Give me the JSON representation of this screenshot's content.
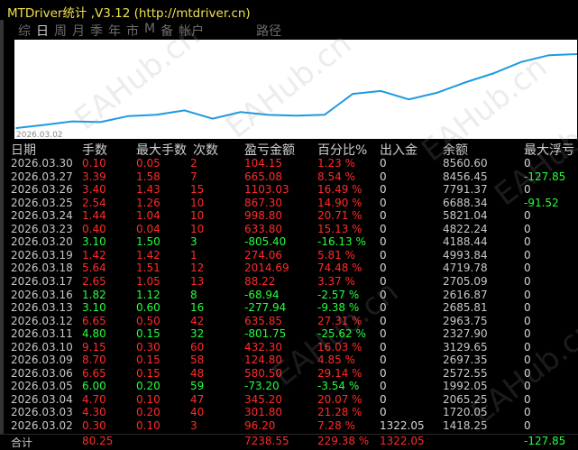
{
  "app": {
    "title": "MTDriver统计 ,V3.12 (http://mtdriver.cn)"
  },
  "tabs": [
    {
      "label": "综"
    },
    {
      "label": "日"
    },
    {
      "label": "周"
    },
    {
      "label": "月"
    },
    {
      "label": "季"
    },
    {
      "label": "年"
    },
    {
      "label": "市"
    },
    {
      "label": "M"
    },
    {
      "label": "备"
    },
    {
      "label": "帐户"
    },
    {
      "label": "路径"
    }
  ],
  "chart_data": {
    "type": "line",
    "x": [
      "2026.03.02",
      "2026.03.03",
      "2026.03.04",
      "2026.03.05",
      "2026.03.06",
      "2026.03.09",
      "2026.03.10",
      "2026.03.11",
      "2026.03.12",
      "2026.03.13",
      "2026.03.16",
      "2026.03.17",
      "2026.03.18",
      "2026.03.19",
      "2026.03.20",
      "2026.03.23",
      "2026.03.24",
      "2026.03.25",
      "2026.03.26",
      "2026.03.27",
      "2026.03.30"
    ],
    "values": [
      1418.25,
      1720.05,
      2065.25,
      1992.05,
      2572.55,
      2697.35,
      3129.65,
      2327.9,
      2963.75,
      2685.81,
      2616.87,
      2705.09,
      4719.78,
      4993.84,
      4188.44,
      4822.24,
      5821.04,
      6688.34,
      7791.37,
      8456.45,
      8560.6
    ],
    "start_label": "2026.03.02",
    "color": "#1e9ae0",
    "grid": false
  },
  "table": {
    "headers": {
      "date": "日期",
      "lots": "手数",
      "max_lots": "最大手数",
      "max_count": "次数",
      "pl": "盈亏金额",
      "pct": "百分比%",
      "io": "出入金",
      "balance": "余额",
      "float": "最大浮亏"
    },
    "rows": [
      {
        "date": "2026.03.30",
        "lots": "0.10",
        "max_lots": "0.05",
        "max_count": "2",
        "pl": "104.15",
        "pct": "1.23 %",
        "io": "0",
        "balance": "8560.60",
        "float": "0",
        "sign": "red"
      },
      {
        "date": "2026.03.27",
        "lots": "3.39",
        "max_lots": "1.58",
        "max_count": "7",
        "pl": "665.08",
        "pct": "8.54 %",
        "io": "0",
        "balance": "8456.45",
        "float": "-127.85",
        "sign": "red"
      },
      {
        "date": "2026.03.26",
        "lots": "3.40",
        "max_lots": "1.43",
        "max_count": "15",
        "pl": "1103.03",
        "pct": "16.49 %",
        "io": "0",
        "balance": "7791.37",
        "float": "0",
        "sign": "red"
      },
      {
        "date": "2026.03.25",
        "lots": "2.54",
        "max_lots": "1.26",
        "max_count": "10",
        "pl": "867.30",
        "pct": "14.90 %",
        "io": "0",
        "balance": "6688.34",
        "float": "-91.52",
        "sign": "red"
      },
      {
        "date": "2026.03.24",
        "lots": "1.44",
        "max_lots": "1.04",
        "max_count": "10",
        "pl": "998.80",
        "pct": "20.71 %",
        "io": "0",
        "balance": "5821.04",
        "float": "0",
        "sign": "red"
      },
      {
        "date": "2026.03.23",
        "lots": "0.40",
        "max_lots": "0.04",
        "max_count": "10",
        "pl": "633.80",
        "pct": "15.13 %",
        "io": "0",
        "balance": "4822.24",
        "float": "0",
        "sign": "red"
      },
      {
        "date": "2026.03.20",
        "lots": "3.10",
        "max_lots": "1.50",
        "max_count": "3",
        "pl": "-805.40",
        "pct": "-16.13 %",
        "io": "0",
        "balance": "4188.44",
        "float": "0",
        "sign": "green"
      },
      {
        "date": "2026.03.19",
        "lots": "1.42",
        "max_lots": "1.42",
        "max_count": "1",
        "pl": "274.06",
        "pct": "5.81 %",
        "io": "0",
        "balance": "4993.84",
        "float": "0",
        "sign": "red"
      },
      {
        "date": "2026.03.18",
        "lots": "5.64",
        "max_lots": "1.51",
        "max_count": "12",
        "pl": "2014.69",
        "pct": "74.48 %",
        "io": "0",
        "balance": "4719.78",
        "float": "0",
        "sign": "red"
      },
      {
        "date": "2026.03.17",
        "lots": "2.65",
        "max_lots": "1.05",
        "max_count": "13",
        "pl": "88.22",
        "pct": "3.37 %",
        "io": "0",
        "balance": "2705.09",
        "float": "0",
        "sign": "red"
      },
      {
        "date": "2026.03.16",
        "lots": "1.82",
        "max_lots": "1.12",
        "max_count": "8",
        "pl": "-68.94",
        "pct": "-2.57 %",
        "io": "0",
        "balance": "2616.87",
        "float": "0",
        "sign": "green"
      },
      {
        "date": "2026.03.13",
        "lots": "3.10",
        "max_lots": "0.60",
        "max_count": "16",
        "pl": "-277.94",
        "pct": "-9.38 %",
        "io": "0",
        "balance": "2685.81",
        "float": "0",
        "sign": "green"
      },
      {
        "date": "2026.03.12",
        "lots": "6.65",
        "max_lots": "0.50",
        "max_count": "42",
        "pl": "635.85",
        "pct": "27.31 %",
        "io": "0",
        "balance": "2963.75",
        "float": "0",
        "sign": "red"
      },
      {
        "date": "2026.03.11",
        "lots": "4.80",
        "max_lots": "0.15",
        "max_count": "32",
        "pl": "-801.75",
        "pct": "-25.62 %",
        "io": "0",
        "balance": "2327.90",
        "float": "0",
        "sign": "green"
      },
      {
        "date": "2026.03.10",
        "lots": "9.15",
        "max_lots": "0.30",
        "max_count": "60",
        "pl": "432.30",
        "pct": "16.03 %",
        "io": "0",
        "balance": "3129.65",
        "float": "0",
        "sign": "red"
      },
      {
        "date": "2026.03.09",
        "lots": "8.70",
        "max_lots": "0.15",
        "max_count": "58",
        "pl": "124.80",
        "pct": "4.85 %",
        "io": "0",
        "balance": "2697.35",
        "float": "0",
        "sign": "red"
      },
      {
        "date": "2026.03.06",
        "lots": "6.65",
        "max_lots": "0.15",
        "max_count": "48",
        "pl": "580.50",
        "pct": "29.14 %",
        "io": "0",
        "balance": "2572.55",
        "float": "0",
        "sign": "red"
      },
      {
        "date": "2026.03.05",
        "lots": "6.00",
        "max_lots": "0.20",
        "max_count": "59",
        "pl": "-73.20",
        "pct": "-3.54 %",
        "io": "0",
        "balance": "1992.05",
        "float": "0",
        "sign": "green"
      },
      {
        "date": "2026.03.04",
        "lots": "4.70",
        "max_lots": "0.10",
        "max_count": "47",
        "pl": "345.20",
        "pct": "20.07 %",
        "io": "0",
        "balance": "2065.25",
        "float": "0",
        "sign": "red"
      },
      {
        "date": "2026.03.03",
        "lots": "4.30",
        "max_lots": "0.20",
        "max_count": "40",
        "pl": "301.80",
        "pct": "21.28 %",
        "io": "0",
        "balance": "1720.05",
        "float": "0",
        "sign": "red"
      },
      {
        "date": "2026.03.02",
        "lots": "0.30",
        "max_lots": "0.10",
        "max_count": "3",
        "pl": "96.20",
        "pct": "7.28 %",
        "io": "1322.05",
        "balance": "1418.25",
        "float": "0",
        "sign": "red"
      }
    ],
    "total": {
      "label": "合计",
      "lots": "80.25",
      "pl": "7238.55",
      "pct": "229.38 %",
      "io": "1322.05",
      "float": "-127.85"
    }
  },
  "watermarks": [
    "EAHub.cn",
    "EAHub.cn",
    "EAHub.cn",
    "EAHub.cn",
    "EAHub.cn",
    "EAHub.cn"
  ],
  "colors": {
    "profit": "#ff2a2a",
    "loss": "#26ff3a",
    "title": "#f0e14a",
    "line": "#1e9ae0"
  }
}
